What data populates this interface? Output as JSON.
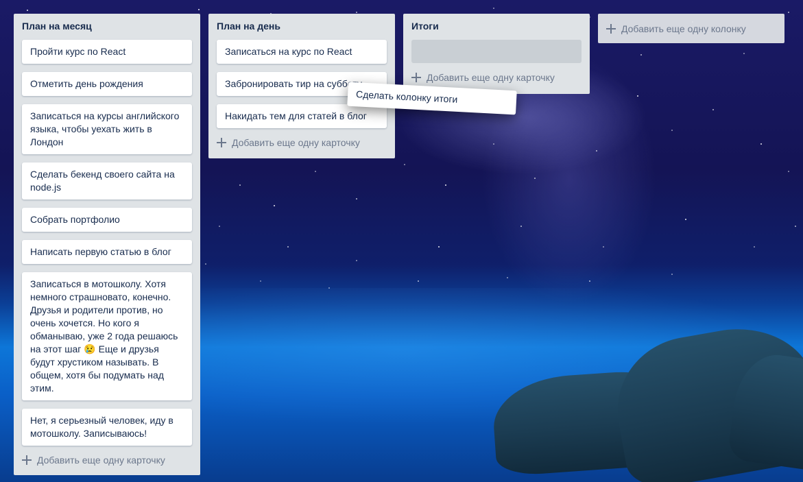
{
  "board": {
    "columns": [
      {
        "title": "План на месяц",
        "cards": [
          "Пройти курс по React",
          "Отметить день рождения",
          "Записаться на курсы английского языка, чтобы уехать жить в Лондон",
          "Сделать бекенд своего сайта на node.js",
          "Собрать портфолио",
          "Написать первую статью в блог",
          "Записаться в мотошколу. Хотя немного страшновато, конечно. Друзья и родители против, но очень хочется. Но кого я обманываю, уже 2 года решаюсь на этот шаг 😢 Еще и друзья будут хрустиком называть. В общем, хотя бы подумать над этим.",
          "Нет, я серьезный человек, иду в мотошколу. Записываюсь!"
        ],
        "add_card_label": "Добавить еще одну карточку"
      },
      {
        "title": "План на день",
        "cards": [
          "Записаться на курс по React",
          "Забронировать тир на субботу",
          "Накидать тем для статей в блог"
        ],
        "add_card_label": "Добавить еще одну карточку"
      },
      {
        "title": "Итоги",
        "cards": [],
        "add_card_label": "Добавить еще одну карточку"
      }
    ],
    "add_column_label": "Добавить еще одну колонку",
    "dragging_card": "Сделать колонку итоги"
  },
  "icons": {
    "add": "plus-icon"
  }
}
